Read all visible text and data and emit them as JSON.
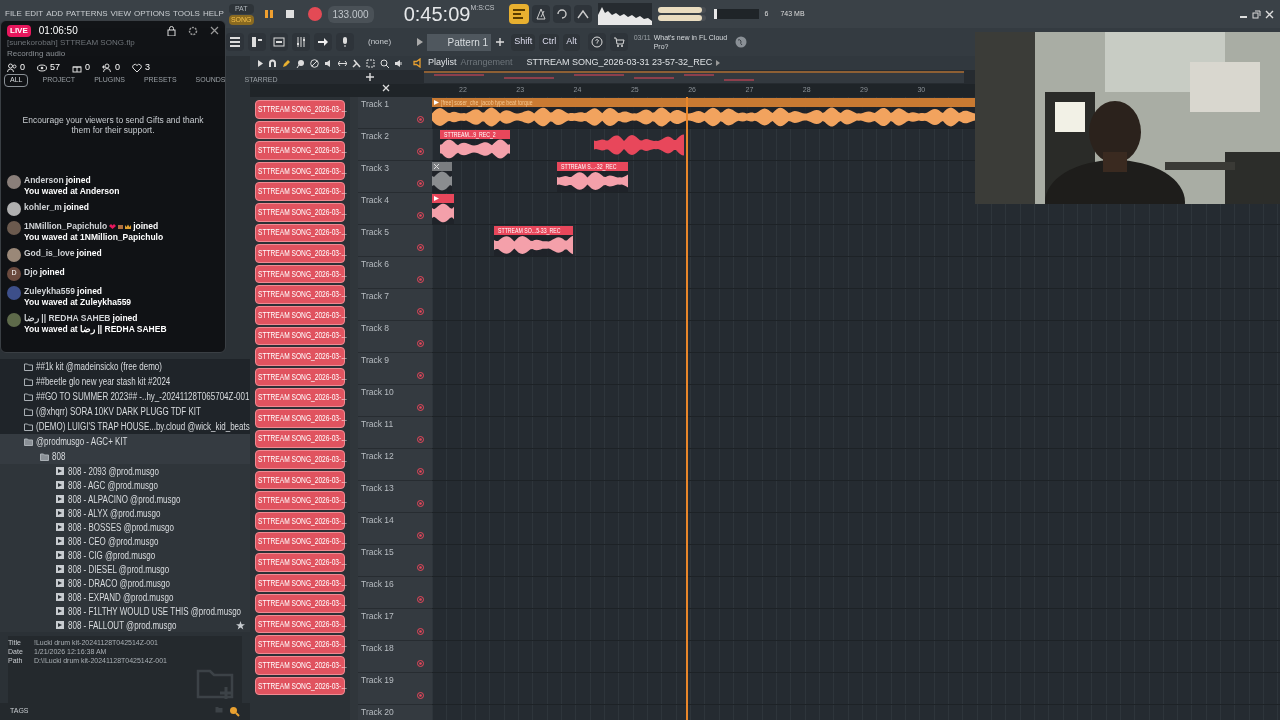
{
  "menu": [
    "FILE",
    "EDIT",
    "ADD",
    "PATTERNS",
    "VIEW",
    "OPTIONS",
    "TOOLS",
    "HELP"
  ],
  "mode_toggle": [
    {
      "label": "PAT",
      "selected": false
    },
    {
      "label": "SONG",
      "selected": true
    }
  ],
  "transport": {
    "recording": true,
    "tempo": "133.000",
    "time": "0:45:09",
    "time_format": "M:S:CS"
  },
  "monitor": {
    "level": 0.08,
    "voices": "6",
    "memory": "743 MB",
    "master_sliders": [
      {
        "level": 0.92
      },
      {
        "level": 0.92
      }
    ]
  },
  "toolbar": {
    "channel": "(none)",
    "pattern": "Pattern 1",
    "keys": [
      "Shift",
      "Ctrl",
      "Alt"
    ],
    "news_date": "03/11",
    "news": "What's new in FL Cloud Pro?"
  },
  "live": {
    "badge": "LIVE",
    "duration": "01:06:50",
    "project": "[sunekorobah] STTREAM SONG.flp",
    "status": "Recording audio",
    "stats": [
      {
        "kind": "guests",
        "value": "0"
      },
      {
        "kind": "views",
        "value": "57"
      },
      {
        "kind": "gifts",
        "value": "0"
      },
      {
        "kind": "follows",
        "value": "0"
      },
      {
        "kind": "likes",
        "value": "3"
      }
    ],
    "tip": "Encourage your viewers to send Gifts and thank them for their support.",
    "chat": [
      {
        "user": "Anderson",
        "action": "joined",
        "wave": "You waved at Anderson",
        "color": "#8a7f7a",
        "badges": false
      },
      {
        "user": "kohler_m",
        "action": "joined",
        "color": "#b0b0b0",
        "badges": false
      },
      {
        "user": "1NMillion_Papichulo",
        "action": "joined",
        "wave": "You waved at 1NMillion_Papichulo",
        "color": "#6b5a4e",
        "badges": true
      },
      {
        "user": "God_is_love",
        "action": "joined",
        "color": "#9a8878",
        "badges": false
      },
      {
        "user": "Djo",
        "action": "joined",
        "initial": "D",
        "color": "#6b4a3e",
        "badges": false
      },
      {
        "user": "Zuleykha559",
        "action": "joined",
        "wave": "You waved at Zuleykha559",
        "color": "#3d4f8a",
        "badges": false
      },
      {
        "user": "رضا || REDHA SAHEB",
        "action": "joined",
        "wave": "You waved at رضا || REDHA SAHEB",
        "color": "#5e6a4a",
        "badges": false
      }
    ]
  },
  "browser": {
    "tabs": [
      {
        "label": "ALL",
        "selected": true
      },
      {
        "label": "PROJECT",
        "selected": false
      },
      {
        "label": "PLUGINS",
        "selected": false
      },
      {
        "label": "PRESETS",
        "selected": false
      },
      {
        "label": "SOUNDS",
        "selected": false
      },
      {
        "label": "STARRED",
        "selected": false
      }
    ],
    "tree": [
      {
        "kind": "folder",
        "label": "##1k kit @madeinsicko (free demo)",
        "expanded": false
      },
      {
        "kind": "folder",
        "label": "##beetle glo new year stash kit #2024",
        "expanded": false
      },
      {
        "kind": "folder",
        "label": "##GO TO SUMMER 2023## -..hy_-20241128T065704Z-001",
        "expanded": false
      },
      {
        "kind": "folder",
        "label": "(@xhqrr) SORA 10KV DARK PLUGG TDF KIT",
        "expanded": false
      },
      {
        "kind": "folder",
        "label": "(DEMO) LUIGI'S TRAP HOUSE...by.cloud @wick_kid_beats",
        "expanded": false
      },
      {
        "kind": "folder",
        "label": "@prodmusgo - AGC+ KIT",
        "expanded": true,
        "children": [
          {
            "kind": "folder",
            "label": "808",
            "expanded": true,
            "children": [
              {
                "kind": "file",
                "label": "808 - 2093 @prod.musgo",
                "starred": false
              },
              {
                "kind": "file",
                "label": "808 - AGC @prod.musgo",
                "starred": false
              },
              {
                "kind": "file",
                "label": "808 - ALPACINO @prod.musgo",
                "starred": false
              },
              {
                "kind": "file",
                "label": "808 - ALYX @prod.musgo",
                "starred": false
              },
              {
                "kind": "file",
                "label": "808 - BOSSES @prod.musgo",
                "starred": false
              },
              {
                "kind": "file",
                "label": "808 - CEO @prod.musgo",
                "starred": false
              },
              {
                "kind": "file",
                "label": "808 - CIG @prod.musgo",
                "starred": false
              },
              {
                "kind": "file",
                "label": "808 - DIESEL @prod.musgo",
                "starred": false
              },
              {
                "kind": "file",
                "label": "808 - DRACO @prod.musgo",
                "starred": false
              },
              {
                "kind": "file",
                "label": "808 - EXPAND @prod.musgo",
                "starred": false
              },
              {
                "kind": "file",
                "label": "808 - F1LTHY WOULD USE THIS @prod.musgo",
                "starred": false
              },
              {
                "kind": "file",
                "label": "808 - FALLOUT @prod.musgo",
                "starred": true
              }
            ]
          }
        ]
      }
    ],
    "info": [
      {
        "label": "Title",
        "value": "!Lucki drum kit-20241128T042514Z-001"
      },
      {
        "label": "Date",
        "value": "1/21/2026 12:16:38 AM"
      },
      {
        "label": "Path",
        "value": "D:\\!Lucki drum kit-20241128T042514Z-001"
      }
    ],
    "tags_label": "TAGS"
  },
  "playlist": {
    "title": "Playlist",
    "view": "Arrangement",
    "song": "STTREAM SONG_2026-03-31 23-57-32_REC",
    "ruler": [
      "22",
      "23",
      "24",
      "25",
      "26",
      "27",
      "28",
      "29",
      "30"
    ],
    "patterns": [
      "STTREAM SONG_2026-03-...",
      "STTREAM SONG_2026-03-...",
      "STTREAM SONG_2026-03-...",
      "STTREAM SONG_2026-03-...",
      "STTREAM SONG_2026-03-...",
      "STTREAM SONG_2026-03-...",
      "STTREAM SONG_2026-03-...",
      "STTREAM SONG_2026-03-...",
      "STTREAM SONG_2026-03-...",
      "STTREAM SONG_2026-03-...",
      "STTREAM SONG_2026-03-...",
      "STTREAM SONG_2026-03-...",
      "STTREAM SONG_2026-03-...",
      "STTREAM SONG_2026-03-...",
      "STTREAM SONG_2026-03-...",
      "STTREAM SONG_2026-03-...",
      "STTREAM SONG_2026-03-...",
      "STTREAM SONG_2026-03-...",
      "STTREAM SONG_2026-03-...",
      "STTREAM SONG_2026-03-...",
      "STTREAM SONG_2026-03-...",
      "STTREAM SONG_2026-03-...",
      "STTREAM SONG_2026-03-...",
      "STTREAM SONG_2026-03-...",
      "STTREAM SONG_2026-03-...",
      "STTREAM SONG_2026-03-...",
      "STTREAM SONG_2026-03-...",
      "STTREAM SONG_2026-03-...",
      "STTREAM SONG_2026-03-..."
    ],
    "tracks": [
      {
        "name": "Track 1",
        "clips": [
          {
            "kind": "labeled",
            "label": "[free] soser_che_jacob type beat torque",
            "color": "#f2a35e",
            "muted": false
          }
        ]
      },
      {
        "name": "Track 2",
        "clips": [
          {
            "kind": "labeled",
            "label": "STTREAM...9_REC_2",
            "color": "#e8475b",
            "muted": false
          },
          {
            "kind": "bare",
            "color": "#e8475b",
            "muted": false
          }
        ]
      },
      {
        "name": "Track 3",
        "clips": [
          {
            "kind": "labeled",
            "color": "#7a7d80",
            "muted": true
          },
          {
            "kind": "labeled",
            "label": "STTREAM S...-32_REC",
            "color": "#e8475b",
            "muted": false
          }
        ]
      },
      {
        "name": "Track 4",
        "clips": [
          {
            "kind": "labeled",
            "color": "#e8475b",
            "muted": false
          }
        ]
      },
      {
        "name": "Track 5",
        "clips": [
          {
            "kind": "labeled",
            "label": "STTREAM SO...5-33_REC",
            "color": "#e8475b",
            "muted": false
          }
        ]
      },
      {
        "name": "Track 6"
      },
      {
        "name": "Track 7"
      },
      {
        "name": "Track 8"
      },
      {
        "name": "Track 9"
      },
      {
        "name": "Track 10"
      },
      {
        "name": "Track 11"
      },
      {
        "name": "Track 12"
      },
      {
        "name": "Track 13"
      },
      {
        "name": "Track 14"
      },
      {
        "name": "Track 15"
      },
      {
        "name": "Track 16"
      },
      {
        "name": "Track 17"
      },
      {
        "name": "Track 18"
      },
      {
        "name": "Track 19"
      },
      {
        "name": "Track 20"
      }
    ]
  }
}
